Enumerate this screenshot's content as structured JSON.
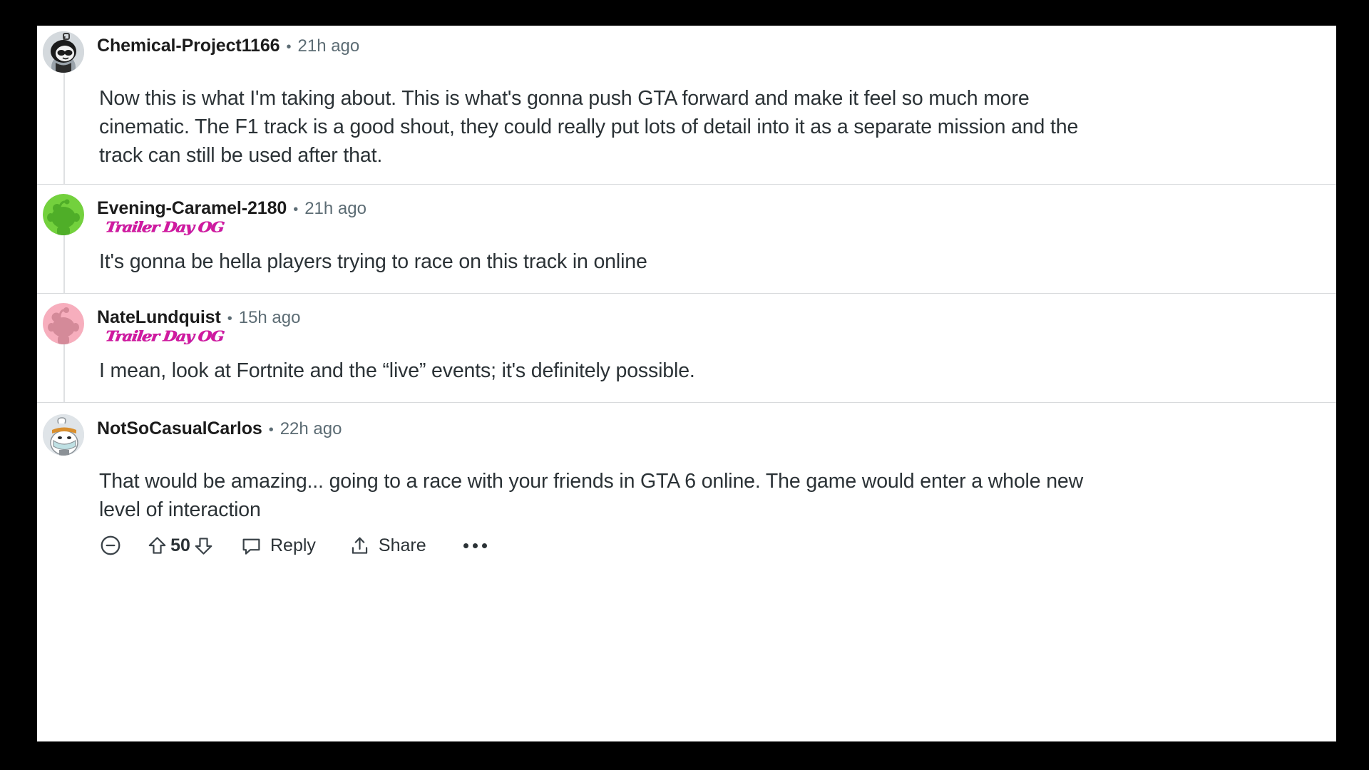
{
  "app": {
    "platform": "reddit-comment-thread"
  },
  "comments": [
    {
      "username": "Chemical-Project1166",
      "separator": "•",
      "timestamp": "21h ago",
      "flair": null,
      "avatar": "snoo-dark-sunglasses",
      "body": "Now this is what I'm taking about. This is what's gonna push GTA forward and make it feel so much more cinematic. The F1 track is a good shout, they could really put lots of detail into it as a separate mission and the track can still be used after that."
    },
    {
      "username": "Evening-Caramel-2180",
      "separator": "•",
      "timestamp": "21h ago",
      "flair": "Trailer Day OG",
      "avatar": "snoo-green",
      "body": "It's gonna be hella players trying to race on this track in online"
    },
    {
      "username": "NateLundquist",
      "separator": "•",
      "timestamp": "15h ago",
      "flair": "Trailer Day OG",
      "avatar": "snoo-pink",
      "body": "I mean, look at Fortnite and the “live” events; it's definitely possible."
    },
    {
      "username": "NotSoCasualCarlos",
      "separator": "•",
      "timestamp": "22h ago",
      "flair": null,
      "avatar": "snoo-chef-hat",
      "body": "That would be amazing... going to a race with your friends in GTA 6 online. The game would enter a whole new level of interaction"
    }
  ],
  "actions": {
    "collapse_icon": "circle-minus-icon",
    "upvote_icon": "upvote-arrow-icon",
    "vote_count": "50",
    "downvote_icon": "downvote-arrow-icon",
    "reply_icon": "comment-bubble-icon",
    "reply_label": "Reply",
    "share_icon": "share-icon",
    "share_label": "Share",
    "overflow_icon": "more-options-icon"
  },
  "colors": {
    "flair_pink": "#d1199e",
    "text": "#2b3236",
    "muted": "#5c6c74",
    "divider": "#d8dadc",
    "thread_line": "#dfe1e3",
    "avatar_green": "#5ecb3c",
    "avatar_pink": "#f4a9b8",
    "background": "#ffffff",
    "letterbox": "#000000"
  }
}
